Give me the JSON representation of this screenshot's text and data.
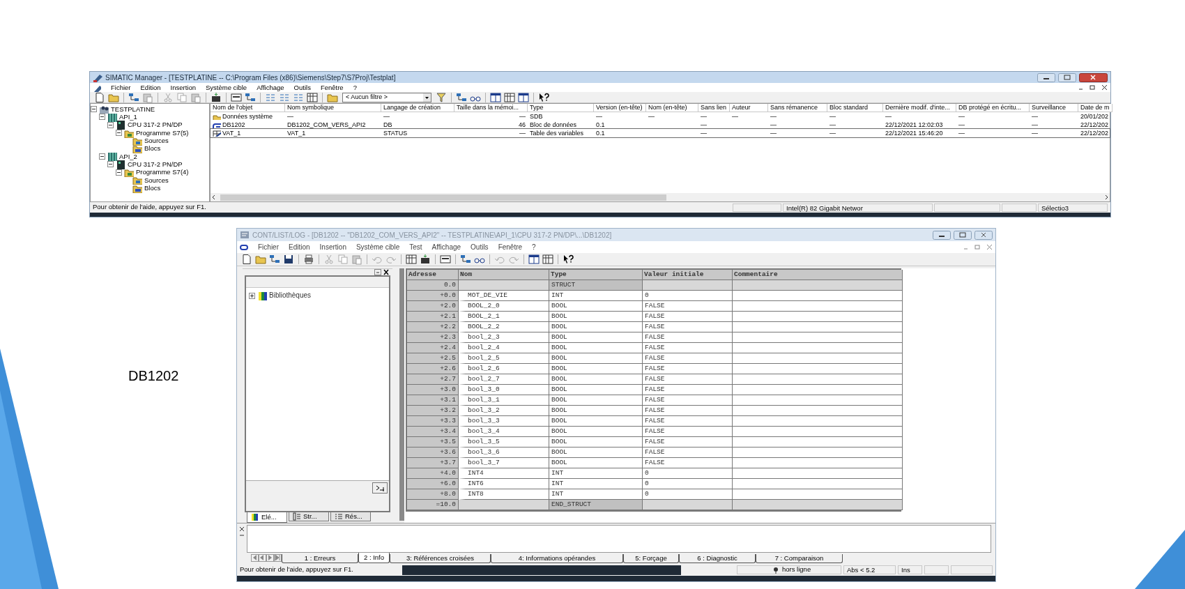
{
  "slide": {
    "label": "DB1202"
  },
  "manager": {
    "title": "SIMATIC Manager - [TESTPLATINE -- C:\\Program Files (x86)\\Siemens\\Step7\\S7Proj\\Testplat]",
    "menu": [
      "Fichier",
      "Edition",
      "Insertion",
      "Système cible",
      "Affichage",
      "Outils",
      "Fenêtre",
      "?"
    ],
    "filter": "< Aucun filtre >",
    "tree": [
      {
        "label": "TESTPLATINE",
        "kind": "project",
        "expanded": true,
        "children": [
          {
            "label": "API_1",
            "kind": "station",
            "expanded": true,
            "children": [
              {
                "label": "CPU 317-2 PN/DP",
                "kind": "cpu",
                "expanded": true,
                "children": [
                  {
                    "label": "Programme S7(5)",
                    "kind": "program",
                    "expanded": true,
                    "children": [
                      {
                        "label": "Sources",
                        "kind": "sources"
                      },
                      {
                        "label": "Blocs",
                        "kind": "blocks"
                      }
                    ]
                  }
                ]
              }
            ]
          },
          {
            "label": "API_2",
            "kind": "station",
            "expanded": true,
            "children": [
              {
                "label": "CPU 317-2 PN/DP",
                "kind": "cpu",
                "expanded": true,
                "children": [
                  {
                    "label": "Programme S7(4)",
                    "kind": "program",
                    "expanded": true,
                    "children": [
                      {
                        "label": "Sources",
                        "kind": "sources"
                      },
                      {
                        "label": "Blocs",
                        "kind": "blocks"
                      }
                    ]
                  }
                ]
              }
            ]
          }
        ]
      }
    ],
    "list": {
      "columns": [
        "Nom de l'objet",
        "Nom symbolique",
        "Langage de création",
        "Taille dans la mémoi...",
        "Type",
        "Version (en-tête)",
        "Nom (en-tête)",
        "Sans lien",
        "Auteur",
        "Sans rémanence",
        "Bloc standard",
        "Dernière modif. d'inte...",
        "DB protégé en écritu...",
        "Surveillance",
        "Date de m"
      ],
      "rows": [
        {
          "kind": "system_data",
          "selected": false,
          "cells": [
            "Données système",
            "—",
            "—",
            "—",
            "SDB",
            "—",
            "—",
            "—",
            "—",
            "—",
            "—",
            "—",
            "—",
            "—",
            "20/01/202"
          ]
        },
        {
          "kind": "data_block",
          "selected": false,
          "cells": [
            "DB1202",
            "DB1202_COM_VERS_API2",
            "DB",
            "46",
            "Bloc de données",
            "0.1",
            "",
            "—",
            "",
            "—",
            "—",
            "22/12/2021 12:02:03",
            "—",
            "—",
            "22/12/202"
          ]
        },
        {
          "kind": "variable_table",
          "selected": true,
          "cells": [
            "VAT_1",
            "VAT_1",
            "STATUS",
            "—",
            "Table des variables",
            "0.1",
            "",
            "—",
            "",
            "—",
            "—",
            "22/12/2021 15:46:20",
            "—",
            "—",
            "22/12/202"
          ]
        }
      ]
    },
    "status_bar": {
      "help": "Pour obtenir de l'aide, appuyez sur F1.",
      "network": "Intel(R) 82 Gigabit Networ",
      "selection": "Sélectio3"
    }
  },
  "editor": {
    "title": "CONT/LIST/LOG - [DB1202 -- \"DB1202_COM_VERS_API2\" -- TESTPLATINE\\API_1\\CPU 317-2 PN/DP\\...\\DB1202]",
    "menu": [
      "Fichier",
      "Edition",
      "Insertion",
      "Système cible",
      "Test",
      "Affichage",
      "Outils",
      "Fenêtre",
      "?"
    ],
    "panel": {
      "tree": [
        {
          "label": "Bibliothèques",
          "kind": "library",
          "expanded": false
        }
      ],
      "tabs": [
        {
          "label": "Elé...",
          "kind": "elements",
          "selected": true
        },
        {
          "label": "Str...",
          "kind": "structure",
          "selected": false
        },
        {
          "label": "Rés...",
          "kind": "results",
          "selected": false
        }
      ]
    },
    "table": {
      "columns": [
        "Adresse",
        "Nom",
        "Type",
        "Valeur initiale",
        "Commentaire"
      ],
      "rows": [
        {
          "kind": "struct",
          "address": "0.0",
          "type": "STRUCT"
        },
        {
          "kind": "field",
          "address": "+0.0",
          "name": "MOT_DE_VIE",
          "type": "INT",
          "initial_value": "0"
        },
        {
          "kind": "field",
          "address": "+2.0",
          "name": "BOOL_2_0",
          "type": "BOOL",
          "initial_value": "FALSE"
        },
        {
          "kind": "field",
          "address": "+2.1",
          "name": "BOOL_2_1",
          "type": "BOOL",
          "initial_value": "FALSE"
        },
        {
          "kind": "field",
          "address": "+2.2",
          "name": "BOOL_2_2",
          "type": "BOOL",
          "initial_value": "FALSE"
        },
        {
          "kind": "field",
          "address": "+2.3",
          "name": "bool_2_3",
          "type": "BOOL",
          "initial_value": "FALSE"
        },
        {
          "kind": "field",
          "address": "+2.4",
          "name": "bool_2_4",
          "type": "BOOL",
          "initial_value": "FALSE"
        },
        {
          "kind": "field",
          "address": "+2.5",
          "name": "bool_2_5",
          "type": "BOOL",
          "initial_value": "FALSE"
        },
        {
          "kind": "field",
          "address": "+2.6",
          "name": "bool_2_6",
          "type": "BOOL",
          "initial_value": "FALSE"
        },
        {
          "kind": "field",
          "address": "+2.7",
          "name": "bool_2_7",
          "type": "BOOL",
          "initial_value": "FALSE"
        },
        {
          "kind": "field",
          "address": "+3.0",
          "name": "bool_3_0",
          "type": "BOOL",
          "initial_value": "FALSE"
        },
        {
          "kind": "field",
          "address": "+3.1",
          "name": "bool_3_1",
          "type": "BOOL",
          "initial_value": "FALSE"
        },
        {
          "kind": "field",
          "address": "+3.2",
          "name": "bool_3_2",
          "type": "BOOL",
          "initial_value": "FALSE"
        },
        {
          "kind": "field",
          "address": "+3.3",
          "name": "bool_3_3",
          "type": "BOOL",
          "initial_value": "FALSE"
        },
        {
          "kind": "field",
          "address": "+3.4",
          "name": "bool_3_4",
          "type": "BOOL",
          "initial_value": "FALSE"
        },
        {
          "kind": "field",
          "address": "+3.5",
          "name": "bool_3_5",
          "type": "BOOL",
          "initial_value": "FALSE"
        },
        {
          "kind": "field",
          "address": "+3.6",
          "name": "bool_3_6",
          "type": "BOOL",
          "initial_value": "FALSE"
        },
        {
          "kind": "field",
          "address": "+3.7",
          "name": "bool_3_7",
          "type": "BOOL",
          "initial_value": "FALSE"
        },
        {
          "kind": "field",
          "address": "+4.0",
          "name": "INT4",
          "type": "INT",
          "initial_value": "0"
        },
        {
          "kind": "field",
          "address": "+6.0",
          "name": "INT6",
          "type": "INT",
          "initial_value": "0"
        },
        {
          "kind": "field",
          "address": "+8.0",
          "name": "INT8",
          "type": "INT",
          "initial_value": "0"
        },
        {
          "kind": "struct",
          "address": "=10.0",
          "type": "END_STRUCT"
        }
      ]
    },
    "output_tabs": [
      {
        "label": "1 : Erreurs",
        "selected": false
      },
      {
        "label": "2 : Info",
        "selected": true
      },
      {
        "label": "3: Références croisées",
        "selected": false
      },
      {
        "label": "4: Informations opérandes",
        "selected": false
      },
      {
        "label": "5: Forçage",
        "selected": false
      },
      {
        "label": "6 : Diagnostic",
        "selected": false
      },
      {
        "label": "7 : Comparaison",
        "selected": false
      }
    ],
    "status_bar": {
      "help": "Pour obtenir de l'aide, appuyez sur F1.",
      "mode": "hors ligne",
      "address": "Abs < 5.2",
      "insert": "Ins"
    }
  }
}
